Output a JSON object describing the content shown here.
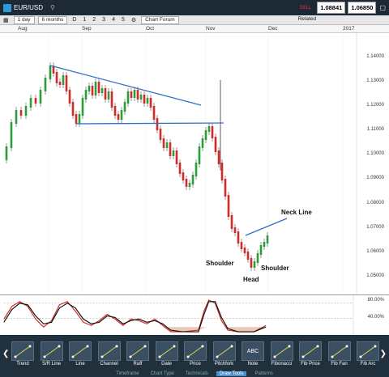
{
  "header": {
    "symbol": "EUR/USD",
    "sell_label": "SELL",
    "sell_price": "1.08841",
    "buy_price": "1.06850"
  },
  "toolbar": {
    "interval": "1 day",
    "range": "6 months",
    "d_label": "D",
    "presets": [
      "1",
      "2",
      "3",
      "4",
      "5"
    ],
    "chart_forum": "Chart Forum",
    "related": "Related"
  },
  "axis": {
    "months": [
      "Aug",
      "Sep",
      "Oct",
      "Nov",
      "Dec",
      "2017"
    ],
    "y_labels": [
      "1.14000",
      "1.13000",
      "1.12000",
      "1.11000",
      "1.10000",
      "1.09000",
      "1.08000",
      "1.07000",
      "1.06000",
      "1.05000"
    ],
    "osc_labels": [
      "80.00%",
      "40.00%"
    ]
  },
  "annotations": {
    "neck_line": "Neck Line",
    "shoulder_left": "Shoulder",
    "shoulder_right": "Shoulder",
    "head": "Head"
  },
  "tools": [
    {
      "name": "trend-tool",
      "label": "Trend"
    },
    {
      "name": "sr-line-tool",
      "label": "S/R Line"
    },
    {
      "name": "line-tool",
      "label": "Line"
    },
    {
      "name": "channel-tool",
      "label": "Channel"
    },
    {
      "name": "raff-tool",
      "label": "Raff"
    },
    {
      "name": "date-tool",
      "label": "Date"
    },
    {
      "name": "price-tool",
      "label": "Price"
    },
    {
      "name": "pitchfork-tool",
      "label": "Pitchfork"
    },
    {
      "name": "note-tool",
      "label": "Note"
    },
    {
      "name": "fibonacci-tool",
      "label": "Fibonacci"
    },
    {
      "name": "fib-price-tool",
      "label": "Fib Price"
    },
    {
      "name": "fib-fan-tool",
      "label": "Fib Fan"
    },
    {
      "name": "fib-arc-tool",
      "label": "Fib Arc"
    }
  ],
  "note_icon_text": "ABC",
  "bottom_tabs": [
    "Timeframe",
    "Chart Type",
    "Technicals",
    "Draw Tools",
    "Patterns"
  ],
  "active_tab": "Draw Tools",
  "colors": {
    "up": "#2a9d3a",
    "down": "#d42a2a",
    "trendline": "#2f6fc8",
    "osc_fill": "#e9c9b4"
  }
}
